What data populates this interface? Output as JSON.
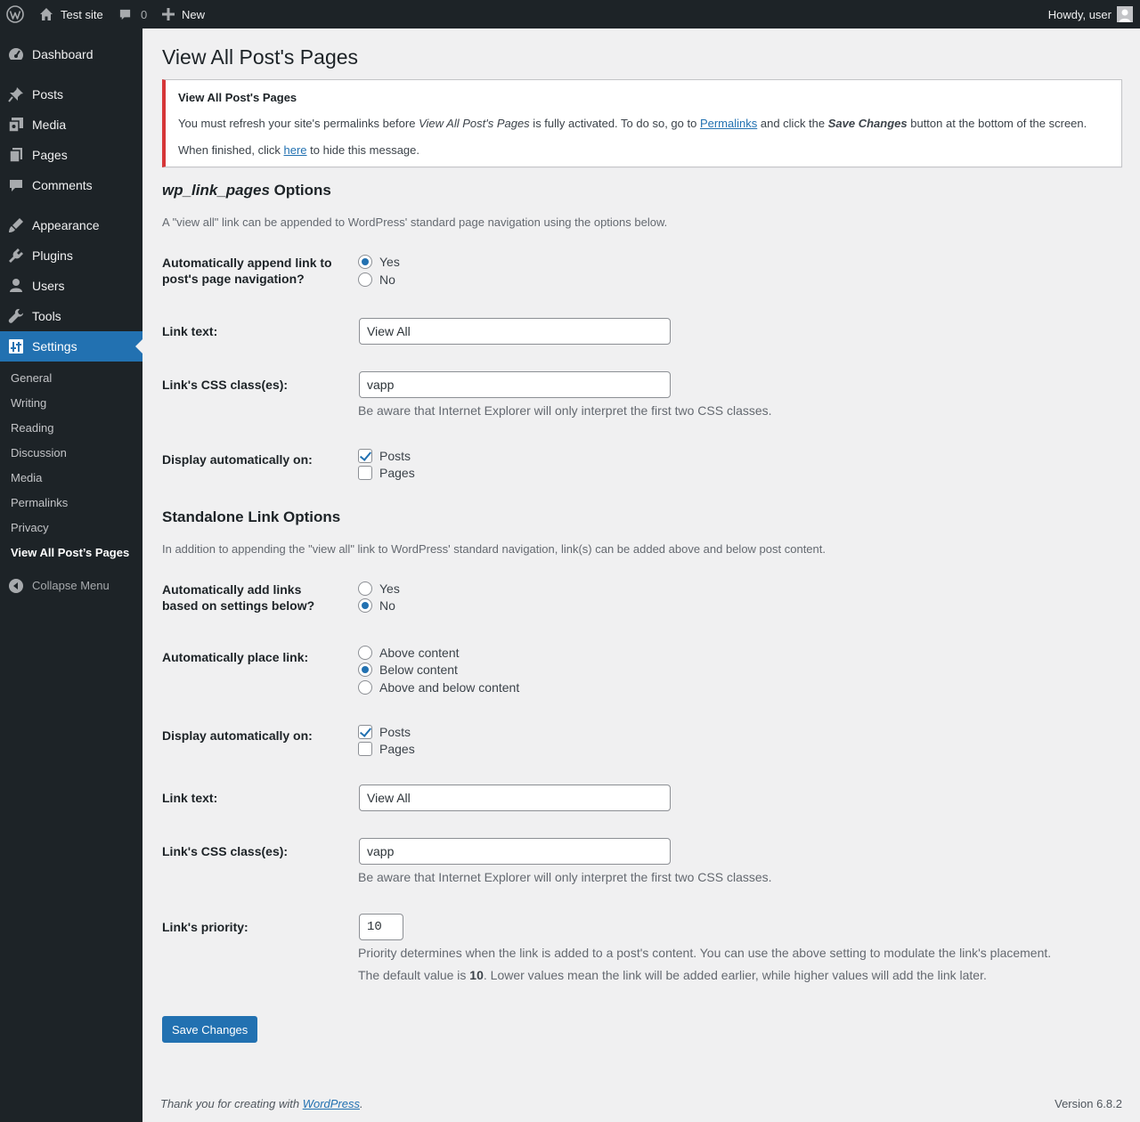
{
  "adminbar": {
    "site_name": "Test site",
    "comments_count": "0",
    "new_label": "New",
    "howdy": "Howdy, user"
  },
  "sidebar": {
    "items": [
      {
        "label": "Dashboard",
        "icon": "dashboard-icon"
      },
      {
        "label": "Posts",
        "icon": "pin-icon"
      },
      {
        "label": "Media",
        "icon": "media-icon"
      },
      {
        "label": "Pages",
        "icon": "pages-icon"
      },
      {
        "label": "Comments",
        "icon": "comment-icon"
      },
      {
        "label": "Appearance",
        "icon": "brush-icon"
      },
      {
        "label": "Plugins",
        "icon": "plug-icon"
      },
      {
        "label": "Users",
        "icon": "user-icon"
      },
      {
        "label": "Tools",
        "icon": "wrench-icon"
      },
      {
        "label": "Settings",
        "icon": "settings-icon",
        "active": true
      }
    ],
    "submenu": [
      "General",
      "Writing",
      "Reading",
      "Discussion",
      "Media",
      "Permalinks",
      "Privacy",
      "View All Post’s Pages"
    ],
    "collapse_label": "Collapse Menu"
  },
  "page": {
    "title": "View All Post's Pages",
    "notice": {
      "title": "View All Post's Pages",
      "line1_a": "You must refresh your site's permalinks before ",
      "line1_em": "View All Post's Pages",
      "line1_b": " is fully activated. To do so, go to ",
      "line1_link": "Permalinks",
      "line1_c": " and click the ",
      "line1_strong": "Save Changes",
      "line1_d": " button at the bottom of the screen.",
      "line2_a": "When finished, click ",
      "line2_link": "here",
      "line2_b": " to hide this message."
    }
  },
  "wlp": {
    "heading_em": "wp_link_pages",
    "heading_rest": " Options",
    "description": "A \"view all\" link can be appended to WordPress' standard page navigation using the options below.",
    "append_label": "Automatically append link to post's page navigation?",
    "append_yes": "Yes",
    "append_no": "No",
    "append_value": "Yes",
    "link_text_label": "Link text:",
    "link_text_value": "View All",
    "css_label": "Link's CSS class(es):",
    "css_value": "vapp",
    "css_help": "Be aware that Internet Explorer will only interpret the first two CSS classes.",
    "display_label": "Display automatically on:",
    "display_posts": "Posts",
    "display_pages": "Pages",
    "display_posts_checked": true,
    "display_pages_checked": false
  },
  "standalone": {
    "heading": "Standalone Link Options",
    "description": "In addition to appending the \"view all\" link to WordPress' standard navigation, link(s) can be added above and below post content.",
    "auto_add_label": "Automatically add links based on settings below?",
    "auto_add_yes": "Yes",
    "auto_add_no": "No",
    "auto_add_value": "No",
    "place_label": "Automatically place link:",
    "place_above": "Above content",
    "place_below": "Below content",
    "place_both": "Above and below content",
    "place_value": "Below content",
    "display_label": "Display automatically on:",
    "display_posts": "Posts",
    "display_pages": "Pages",
    "display_posts_checked": true,
    "display_pages_checked": false,
    "link_text_label": "Link text:",
    "link_text_value": "View All",
    "css_label": "Link's CSS class(es):",
    "css_value": "vapp",
    "css_help": "Be aware that Internet Explorer will only interpret the first two CSS classes.",
    "priority_label": "Link's priority:",
    "priority_value": "10",
    "priority_help1": "Priority determines when the link is added to a post's content. You can use the above setting to modulate the link's placement.",
    "priority_help2_a": "The default value is ",
    "priority_help2_strong": "10",
    "priority_help2_b": ". Lower values mean the link will be added earlier, while higher values will add the link later."
  },
  "save_label": "Save Changes",
  "footer": {
    "thanks_a": "Thank you for creating with ",
    "thanks_link": "WordPress",
    "thanks_b": ".",
    "version": "Version 6.8.2"
  },
  "colors": {
    "admin_dark": "#1d2327",
    "accent": "#2271b1",
    "notice_error": "#d63638",
    "background": "#f0f0f1"
  }
}
